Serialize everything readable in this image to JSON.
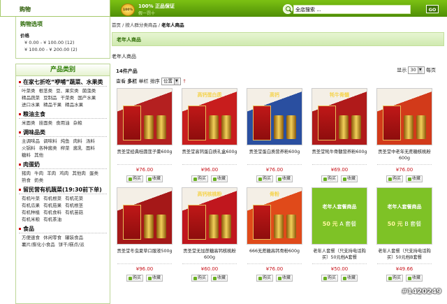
{
  "topbar": {
    "cart_label": "购物",
    "badge_text": "100%",
    "guarantee_line1": "100% 正品保证",
    "guarantee_line2": "假一罚十",
    "search_value": "全店搜索 ...",
    "search_button": "GO"
  },
  "sidebar": {
    "options_title": "购物选项",
    "price_label": "价格",
    "price_ranges": [
      "¥ 0.00 - ¥ 100.00 (12)",
      "¥ 100.00 - ¥ 200.00 (2)"
    ],
    "category_title": "产品类别",
    "categories": [
      {
        "title": "在家七折吃“咿哺”蔬菜、水果类",
        "items": [
          "叶菜类",
          "根茎类",
          "豆、果实类",
          "菌藻类",
          "精品蔬菜",
          "豆制品",
          "干菜类",
          "国产水果",
          "进口水果",
          "精品干果",
          "精品水果"
        ]
      },
      {
        "title": "粮油主食",
        "items": [
          "米面类",
          "挂面类",
          "食用油",
          "杂粮"
        ]
      },
      {
        "title": "调味品类",
        "items": [
          "主调味品",
          "调味料",
          "炖鱼",
          "肉料",
          "汤料",
          "火锅料",
          "各种酱类",
          "榨菜",
          "酱乳",
          "面料",
          "糖料",
          "其他"
        ]
      },
      {
        "title": "肉蛋奶",
        "items": [
          "猪肉",
          "牛肉",
          "羊肉",
          "鸡肉",
          "其他肉",
          "蛋类",
          "熟食",
          "奶类"
        ]
      },
      {
        "title": "留民营有机蔬菜(19:30前下单)",
        "items": [
          "有机叶菜",
          "有机根菜",
          "有机花菜",
          "有机瓜果",
          "有机茄果",
          "有机根茎",
          "有机种植",
          "有机食料",
          "有机苗菇",
          "有机米粮",
          "有机茶油"
        ]
      },
      {
        "title": "食品",
        "items": [
          "方便速食",
          "休闲零食",
          "罐装食品",
          "薯片/膨化小食品",
          "饼干/糕点/派"
        ]
      }
    ]
  },
  "main": {
    "breadcrumb": [
      "首页",
      "按人群分类商品",
      "老年人商品"
    ],
    "section_title": "老年人商品",
    "section_desc": "老年人商品",
    "count": "14件产品",
    "per_page_label": "显示",
    "per_page_value": "30",
    "per_page_suffix": "每页",
    "view_label": "查看",
    "view_mode_grid": "多栏",
    "view_mode_list": "单栏",
    "sort_label": "排序",
    "sort_value": "位置",
    "buy_label": "购买",
    "fav_label": "收藏",
    "products": [
      {
        "name": "贡圣堂经典桂圆莲子羹600g",
        "price": "¥76.00",
        "kind": "photo",
        "cap": "",
        "bg": "#b42020"
      },
      {
        "name": "贡圣堂高钙蛋白质礼盒600g",
        "price": "¥96.00",
        "kind": "photo",
        "cap": "高钙蛋白质",
        "bg": "#c81d1d"
      },
      {
        "name": "贡圣堂蛋白质营养粉600g",
        "price": "¥76.00",
        "kind": "photo",
        "cap": "高钙",
        "bg": "#2a4fa0"
      },
      {
        "name": "贡圣堂牦牛骨髓营养粉600g",
        "price": "¥69.00",
        "kind": "photo",
        "cap": "牦牛骨髓",
        "bg": "#b01a1a"
      },
      {
        "name": "贡圣堂中老年无蔗糖核桃粉600g",
        "price": "¥76.00",
        "kind": "photo",
        "cap": "",
        "bg": "#d23a1a"
      },
      {
        "name": "贡圣堂冬虫夏草口服液500g",
        "price": "¥96.00",
        "kind": "photo",
        "cap": "",
        "bg": "#a51818"
      },
      {
        "name": "贡圣堂无加蔗糖高钙核桃粉600g",
        "price": "¥60.00",
        "kind": "photo",
        "cap": "高钙核桃粉",
        "bg": "#c0171e"
      },
      {
        "name": "666无蔗糖高钙骨粉600g",
        "price": "¥76.00",
        "kind": "photo",
        "cap": "骨粉",
        "bg": "#e04a1a"
      },
      {
        "name": "老年人套餐（只支持电话购买）50元档A套餐",
        "price": "¥50.00",
        "kind": "promo",
        "title": "老年人套餐商品",
        "amount": "50 元",
        "tier": "A 套餐"
      },
      {
        "name": "老年人套餐（只支持电话购买）50元档B套餐",
        "price": "¥49.66",
        "kind": "promo",
        "title": "老年人套餐商品",
        "amount": "50 元",
        "tier": "B 套餐"
      }
    ]
  },
  "watermark": "#1420249"
}
